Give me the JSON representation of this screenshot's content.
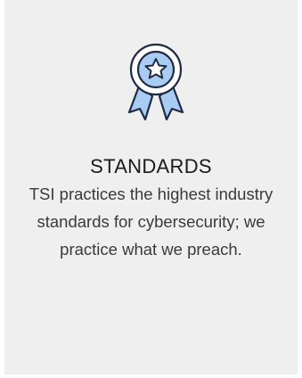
{
  "card": {
    "icon": "award-ribbon-star-icon",
    "title": "STANDARDS",
    "description": "TSI practices the highest industry standards for cybersecurity; we practice what we preach."
  },
  "colors": {
    "card_background": "#efefef",
    "icon_stroke": "#1f2a44",
    "icon_fill": "#a9cdf2"
  }
}
